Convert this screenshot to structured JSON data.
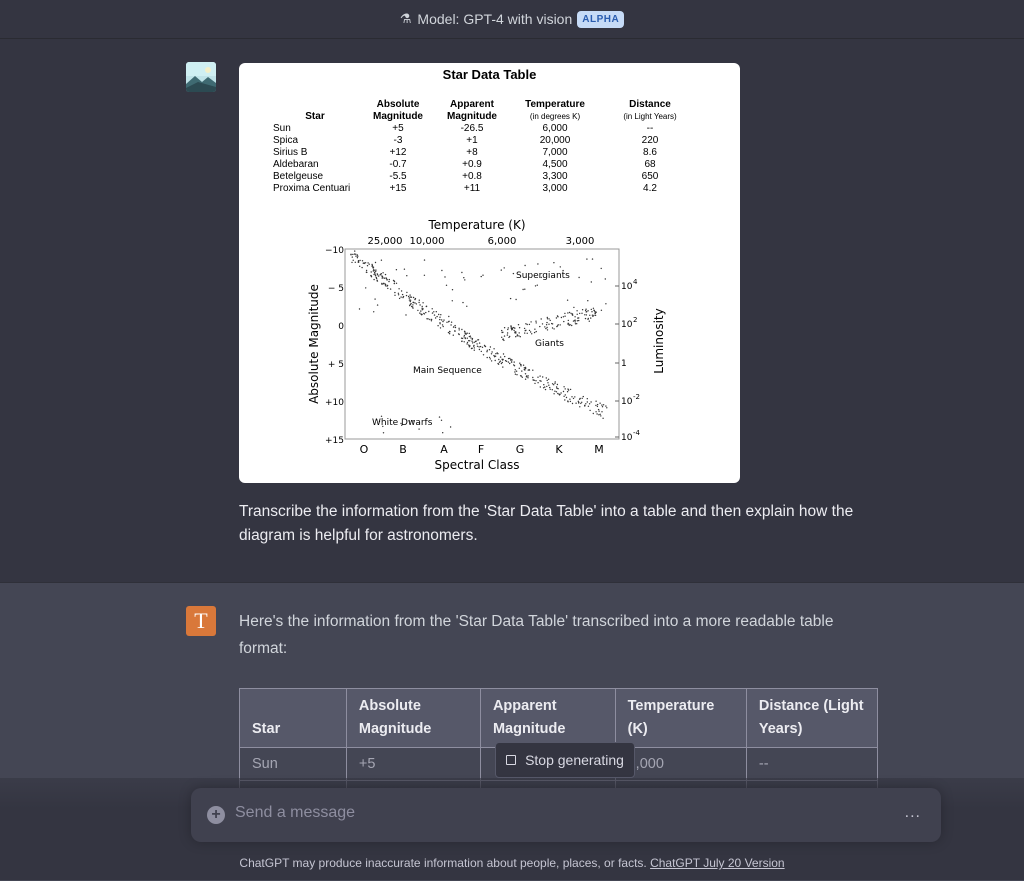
{
  "topbar": {
    "model_label": "Model: GPT-4 with vision",
    "badge": "ALPHA"
  },
  "user_message": {
    "figure": {
      "title": "Star Data Table",
      "columns": [
        {
          "label": "Star"
        },
        {
          "label": "Absolute",
          "label2": "Magnitude"
        },
        {
          "label": "Apparent",
          "label2": "Magnitude"
        },
        {
          "label": "Temperature",
          "sub": "(in degrees K)"
        },
        {
          "label": "Distance",
          "sub": "(in Light Years)"
        }
      ],
      "rows": [
        [
          "Sun",
          "+5",
          "-26.5",
          "6,000",
          "--"
        ],
        [
          "Spica",
          "-3",
          "+1",
          "20,000",
          "220"
        ],
        [
          "Sirius B",
          "+12",
          "+8",
          "7,000",
          "8.6"
        ],
        [
          "Aldebaran",
          "-0.7",
          "+0.9",
          "4,500",
          "68"
        ],
        [
          "Betelgeuse",
          "-5.5",
          "+0.8",
          "3,300",
          "650"
        ],
        [
          "Proxima Centuari",
          "+15",
          "+11",
          "3,000",
          "4.2"
        ]
      ],
      "diagram": {
        "top_axis_label": "Temperature (K)",
        "top_ticks": [
          "25,000",
          "10,000",
          "6,000",
          "3,000"
        ],
        "left_axis_label": "Absolute Magnitude",
        "left_ticks": [
          "−10",
          "− 5",
          "0",
          "+ 5",
          "+10",
          "+15"
        ],
        "right_axis_label": "Luminosity",
        "right_ticks": [
          "10",
          "10",
          "1",
          "10",
          "10"
        ],
        "right_exponents": [
          "4",
          "2",
          "",
          "-2",
          "-4"
        ],
        "bottom_axis_label": "Spectral Class",
        "bottom_ticks": [
          "O",
          "B",
          "A",
          "F",
          "G",
          "K",
          "M"
        ],
        "region_labels": {
          "supergiants": "Supergiants",
          "giants": "Giants",
          "main_sequence": "Main Sequence",
          "white_dwarfs": "White Dwarfs"
        }
      }
    },
    "text": "Transcribe the information from the 'Star Data Table' into a table and then explain how the diagram is helpful for astronomers."
  },
  "assistant_message": {
    "text": "Here's the information from the 'Star Data Table' transcribed into a more readable table format:",
    "table_headers": [
      [
        "Star",
        ""
      ],
      [
        "Absolute",
        "Magnitude"
      ],
      [
        "Apparent",
        "Magnitude"
      ],
      [
        "Temperature",
        "(K)"
      ],
      [
        "Distance (Light",
        "Years)"
      ]
    ],
    "table_rows": [
      [
        "Sun",
        "+5",
        "",
        "6,000",
        "--"
      ]
    ]
  },
  "stop_button": "Stop generating",
  "composer": {
    "placeholder": "Send a message",
    "more": "..."
  },
  "footer": {
    "text": "ChatGPT may produce inaccurate information about people, places, or facts. ",
    "link": "ChatGPT July 20 Version"
  },
  "colors": {
    "background": "#343541",
    "assistant_bg": "#444654",
    "bot_avatar": "#d9783a",
    "badge_bg": "#c6dbf7"
  },
  "icons": [
    "flask-icon",
    "user-avatar-image",
    "bot-avatar-icon",
    "stop-square-icon",
    "plus-icon",
    "more-dots-icon"
  ]
}
